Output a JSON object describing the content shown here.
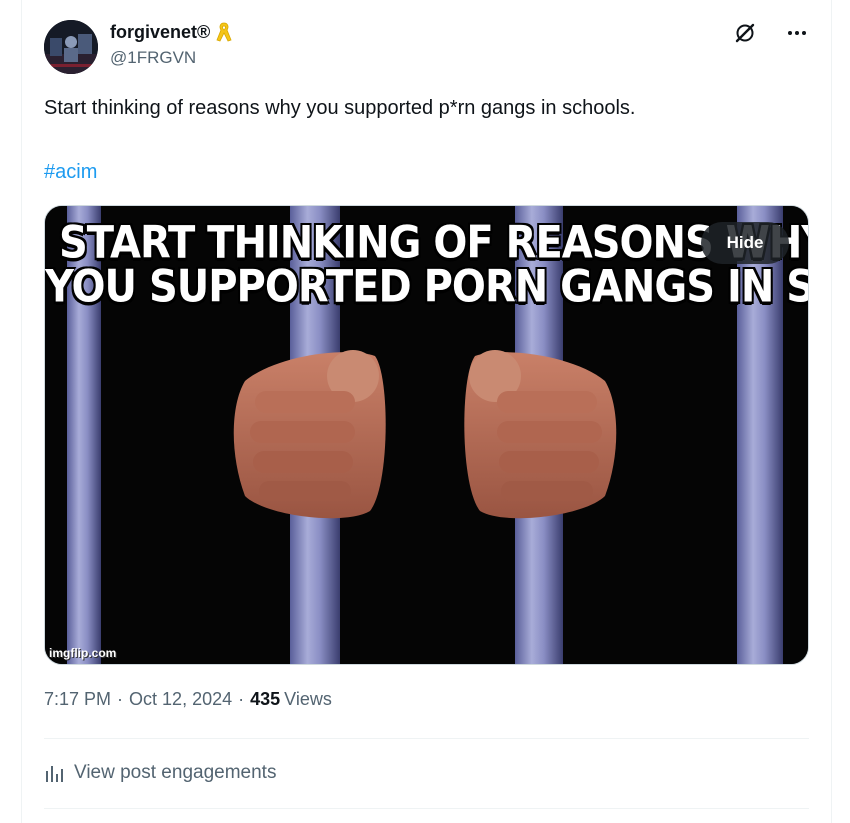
{
  "author": {
    "display_name": "forgivenet®",
    "handle": "@1FRGVN"
  },
  "icons": {
    "verified_ribbon": "yellow-ribbon-icon",
    "grok": "grok-icon",
    "more": "more-icon",
    "engagements": "bar-chart-icon"
  },
  "tweet": {
    "text": "Start thinking of reasons why you supported p*rn gangs in schools.",
    "hashtag": "#acim"
  },
  "media": {
    "caption_line1": "START THINKING OF REASONS WHY",
    "caption_line2": "YOU SUPPORTED PORN GANGS IN SCHOOLS",
    "watermark": "imgflip.com",
    "hide_label": "Hide"
  },
  "meta": {
    "time": "7:17 PM",
    "date": "Oct 12, 2024",
    "separator": "·",
    "views_count": "435",
    "views_label": "Views"
  },
  "engagements": {
    "label": "View post engagements"
  },
  "colors": {
    "accent": "#1d9bf0",
    "secondary_text": "#536471",
    "ribbon": "#f5c518"
  }
}
